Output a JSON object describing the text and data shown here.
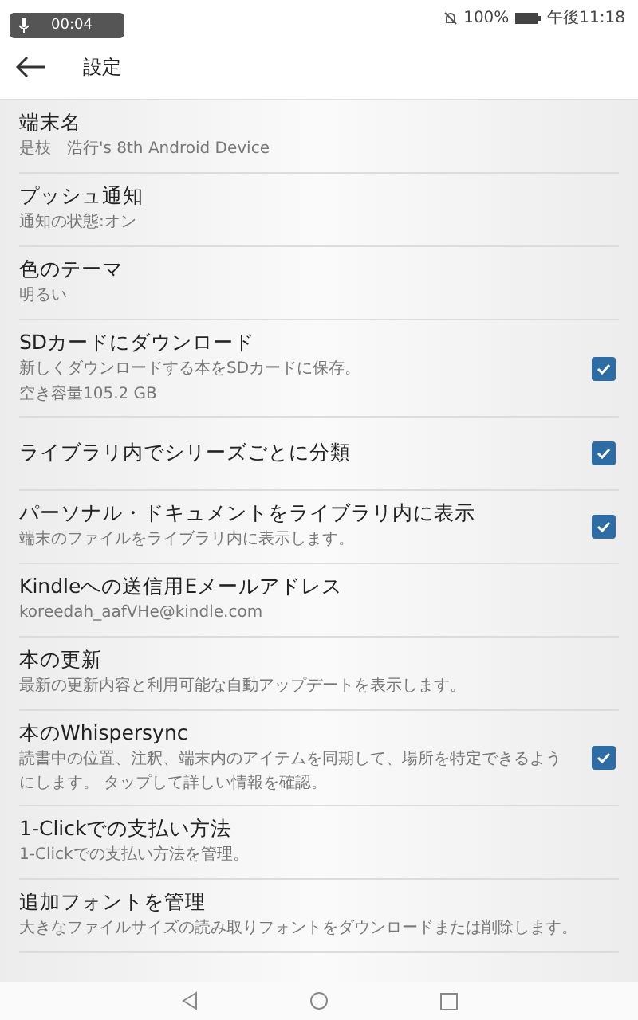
{
  "status_bar": {
    "recording_time": "00:04",
    "battery": "100%",
    "time": "午後11:18"
  },
  "header": {
    "title": "設定"
  },
  "settings": [
    {
      "kind": "info",
      "title": "端末名",
      "subtitle": [
        "是枝　浩行's 8th Android Device"
      ]
    },
    {
      "kind": "info",
      "title": "プッシュ通知",
      "subtitle": [
        "通知の状態:オン"
      ]
    },
    {
      "kind": "info",
      "title": "色のテーマ",
      "subtitle": [
        "明るい"
      ]
    },
    {
      "kind": "checkbox",
      "title": "SDカードにダウンロード",
      "subtitle": [
        "新しくダウンロードする本をSDカードに保存。",
        "空き容量105.2 GB"
      ],
      "checked": true
    },
    {
      "kind": "checkbox",
      "title": "ライブラリ内でシリーズごとに分類",
      "checked": true
    },
    {
      "kind": "checkbox",
      "title": "パーソナル・ドキュメントをライブラリ内に表示",
      "subtitle": [
        "端末のファイルをライブラリ内に表示します。"
      ],
      "checked": true
    },
    {
      "kind": "info",
      "title": "Kindleへの送信用Eメールアドレス",
      "subtitle": [
        "koreedah_aafVHe@kindle.com"
      ]
    },
    {
      "kind": "info",
      "title": "本の更新",
      "subtitle": [
        "最新の更新内容と利用可能な自動アップデートを表示します。"
      ]
    },
    {
      "kind": "checkbox",
      "title": "本のWhispersync",
      "subtitle": [
        "読書中の位置、注釈、端末内のアイテムを同期して、場所を特定できるようにします。 タップして詳しい情報を確認。"
      ],
      "checked": true
    },
    {
      "kind": "info",
      "title": "1-Clickでの支払い方法",
      "subtitle": [
        "1-Clickでの支払い方法を管理。"
      ]
    },
    {
      "kind": "info",
      "title": "追加フォントを管理",
      "subtitle": [
        "大きなファイルサイズの読み取りフォントをダウンロードまたは削除します。"
      ]
    }
  ]
}
